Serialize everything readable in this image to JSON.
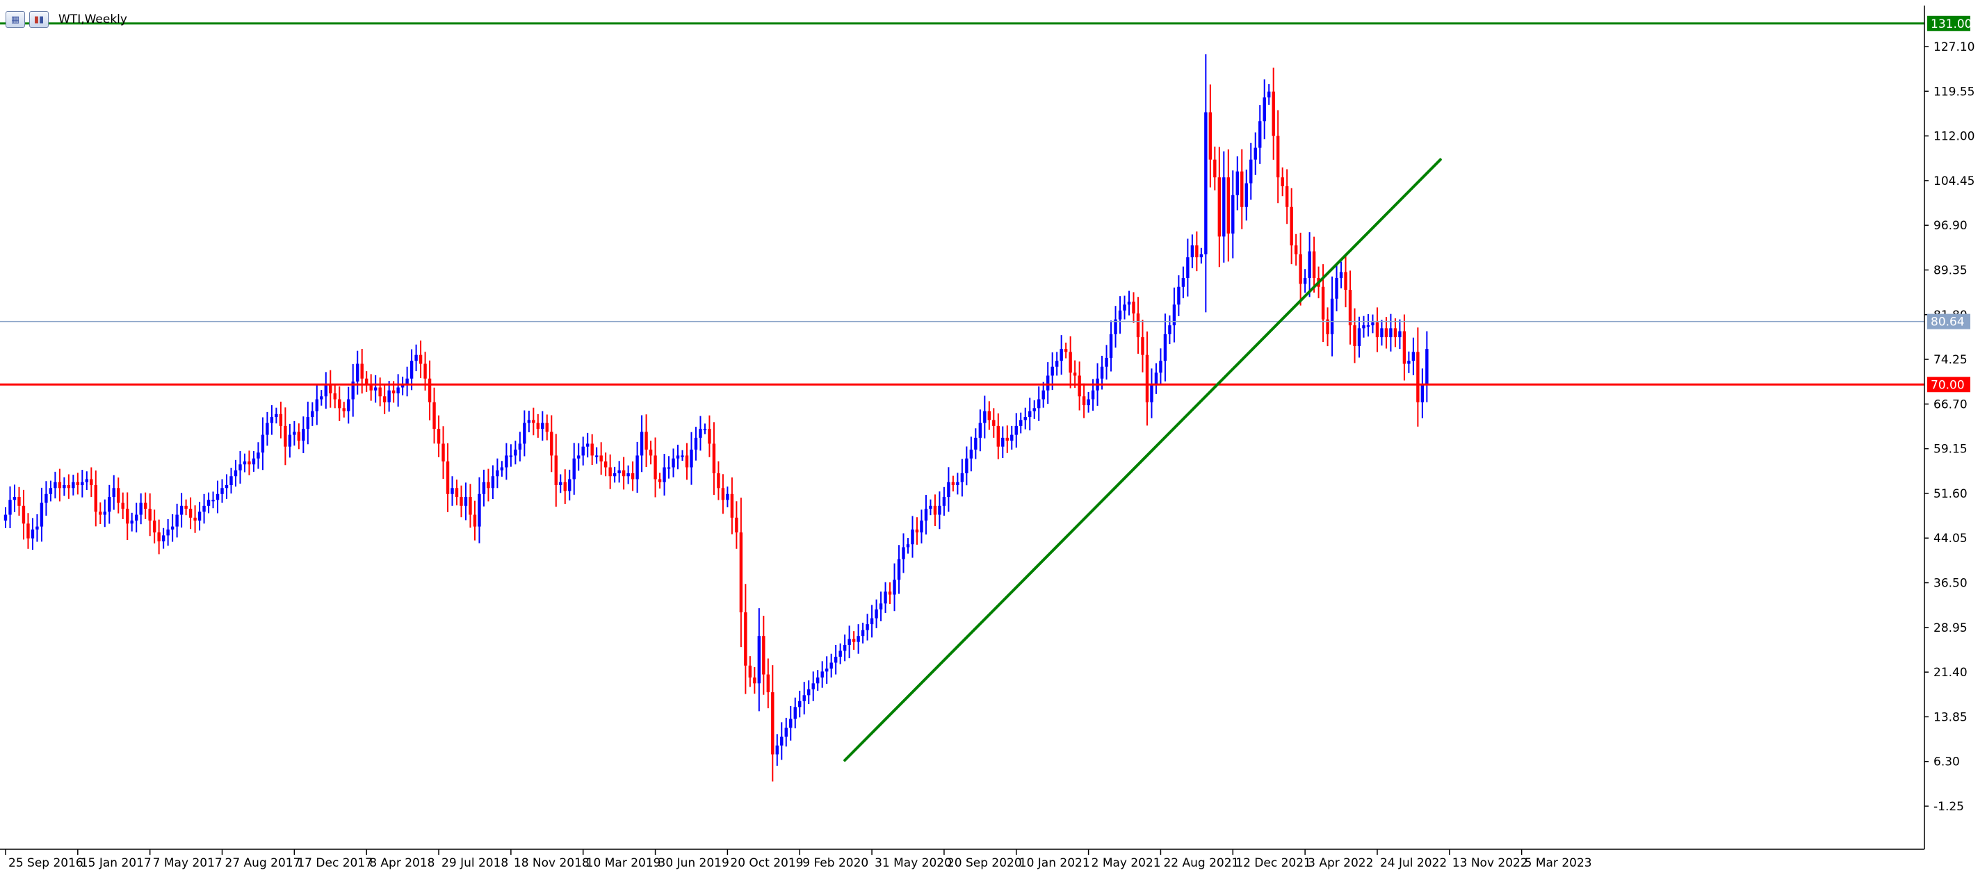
{
  "window": {
    "title": "WTI,Weekly"
  },
  "colors": {
    "bull": "#0000ff",
    "bear": "#ff0000",
    "level_high": "#008000",
    "level_low": "#ff0000",
    "current_price_line": "#8aa4c8",
    "trendline": "#008000"
  },
  "chart_data": {
    "type": "candlestick",
    "symbol": "WTI",
    "timeframe": "Weekly",
    "grid": false,
    "y_ticks": [
      "127.10",
      "119.55",
      "112.00",
      "104.45",
      "96.90",
      "89.35",
      "81.80",
      "74.25",
      "66.70",
      "59.15",
      "51.60",
      "44.05",
      "36.50",
      "28.95",
      "21.40",
      "13.85",
      "6.30",
      "-1.25"
    ],
    "x_ticks": [
      "25 Sep 2016",
      "15 Jan 2017",
      "7 May 2017",
      "27 Aug 2017",
      "17 Dec 2017",
      "8 Apr 2018",
      "29 Jul 2018",
      "18 Nov 2018",
      "10 Mar 2019",
      "30 Jun 2019",
      "20 Oct 2019",
      "9 Feb 2020",
      "31 May 2020",
      "20 Sep 2020",
      "10 Jan 2021",
      "2 May 2021",
      "22 Aug 2021",
      "12 Dec 2021",
      "3 Apr 2022",
      "24 Jul 2022",
      "13 Nov 2022",
      "5 Mar 2023"
    ],
    "horizontal_levels": [
      {
        "price": 131.0,
        "label": "131.00",
        "color": "#008000"
      },
      {
        "price": 70.0,
        "label": "70.00",
        "color": "#ff0000"
      }
    ],
    "current_price": {
      "price": 80.64,
      "label": "80.64"
    },
    "trendline": {
      "from": {
        "date": "2020-04-19",
        "price": 6.5
      },
      "to": {
        "date": "2022-10-30",
        "price": 108.0
      }
    },
    "start_date": "2016-09-25",
    "closes": [
      48.0,
      50.5,
      51.0,
      49.5,
      46.5,
      44.0,
      45.5,
      46.0,
      50.0,
      51.5,
      52.5,
      53.5,
      52.5,
      53.0,
      52.5,
      53.5,
      53.0,
      53.5,
      54.0,
      53.0,
      48.5,
      48.0,
      48.5,
      51.0,
      52.5,
      50.0,
      49.0,
      46.5,
      47.0,
      48.0,
      50.0,
      49.0,
      47.0,
      45.0,
      43.5,
      44.5,
      45.5,
      46.0,
      48.0,
      49.5,
      49.0,
      47.5,
      47.0,
      48.5,
      49.5,
      50.5,
      50.5,
      51.5,
      52.5,
      53.0,
      54.5,
      55.5,
      56.5,
      57.0,
      56.5,
      57.5,
      58.5,
      61.5,
      63.5,
      64.5,
      65.0,
      63.0,
      59.5,
      61.5,
      62.0,
      60.5,
      62.5,
      64.5,
      65.5,
      67.5,
      68.0,
      70.0,
      68.5,
      67.5,
      66.0,
      65.5,
      67.5,
      70.5,
      73.5,
      71.0,
      70.0,
      69.0,
      69.5,
      68.0,
      67.0,
      69.0,
      68.5,
      69.5,
      70.0,
      71.0,
      74.0,
      75.0,
      73.5,
      71.0,
      67.0,
      62.5,
      60.0,
      57.0,
      51.5,
      52.5,
      51.0,
      49.5,
      51.0,
      48.0,
      46.0,
      51.5,
      53.5,
      52.5,
      54.5,
      55.5,
      56.0,
      58.0,
      58.0,
      59.0,
      60.0,
      63.5,
      64.0,
      63.5,
      62.5,
      63.5,
      62.0,
      58.0,
      53.0,
      53.5,
      52.0,
      54.0,
      57.5,
      58.0,
      59.5,
      60.0,
      58.0,
      58.0,
      57.0,
      56.0,
      54.5,
      55.0,
      55.5,
      54.5,
      55.0,
      54.0,
      58.0,
      62.0,
      59.0,
      58.0,
      54.0,
      53.5,
      56.0,
      56.0,
      57.5,
      58.0,
      58.0,
      56.0,
      59.0,
      61.0,
      62.5,
      62.5,
      60.0,
      55.0,
      52.5,
      50.5,
      51.5,
      47.5,
      45.0,
      31.5,
      22.5,
      20.5,
      19.5,
      27.5,
      21.0,
      18.0,
      7.5,
      9.0,
      10.5,
      12.0,
      13.5,
      15.5,
      16.5,
      17.5,
      18.5,
      19.5,
      20.5,
      21.5,
      22.0,
      23.0,
      24.0,
      25.0,
      26.0,
      27.0,
      26.5,
      27.5,
      28.5,
      29.5,
      30.5,
      32.0,
      33.0,
      35.0,
      34.5,
      37.0,
      40.5,
      42.5,
      43.0,
      45.5,
      45.0,
      47.0,
      49.0,
      49.5,
      48.0,
      49.5,
      51.0,
      53.5,
      53.0,
      53.5,
      55.0,
      57.5,
      59.0,
      61.0,
      63.5,
      65.5,
      64.0,
      63.0,
      59.5,
      61.0,
      60.5,
      61.5,
      63.0,
      64.0,
      64.5,
      65.5,
      66.0,
      67.5,
      69.0,
      71.5,
      73.0,
      74.0,
      76.0,
      75.5,
      72.0,
      71.5,
      68.0,
      66.5,
      67.5,
      69.0,
      71.0,
      73.0,
      74.5,
      78.5,
      81.0,
      82.5,
      83.5,
      84.0,
      82.0,
      78.0,
      75.0,
      67.0,
      70.0,
      72.0,
      74.0,
      78.5,
      80.0,
      83.5,
      86.5,
      88.0,
      91.5,
      93.5,
      91.5,
      92.0,
      116.0,
      108.0,
      105.0,
      95.0,
      105.0,
      95.5,
      102.0,
      106.0,
      100.0,
      104.0,
      108.0,
      110.0,
      114.5,
      118.5,
      119.5,
      112.0,
      105.0,
      103.5,
      100.0,
      93.5,
      92.0,
      87.0,
      88.0,
      92.5,
      88.0,
      86.5,
      81.0,
      78.5,
      84.5,
      88.0,
      89.0,
      86.0,
      80.0,
      76.5,
      79.5,
      80.0,
      80.0,
      80.5,
      78.0,
      79.5,
      78.0,
      79.5,
      78.0,
      79.0,
      73.5,
      74.0,
      75.5,
      67.0,
      70.0,
      76.0
    ]
  }
}
